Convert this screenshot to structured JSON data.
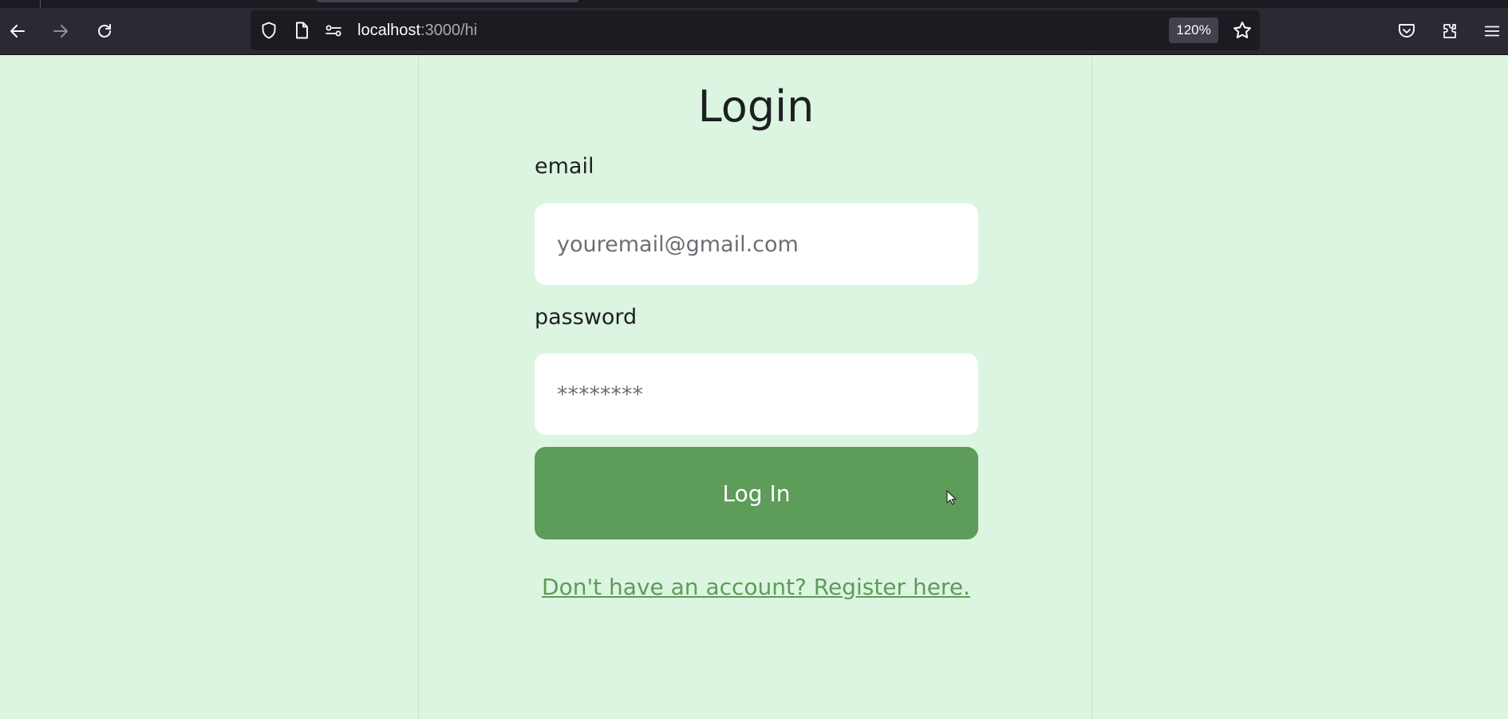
{
  "browser": {
    "url_host": "localhost",
    "url_rest": ":3000/hi",
    "zoom": "120%",
    "icons": {
      "back": "back-arrow-icon",
      "forward": "forward-arrow-icon",
      "reload": "reload-icon",
      "shield": "tracking-protection-shield-icon",
      "page": "page-info-icon",
      "permissions": "permissions-icon",
      "bookmark": "bookmark-star-icon",
      "pocket": "pocket-icon",
      "extensions": "extensions-icon",
      "menu": "hamburger-menu-icon"
    }
  },
  "login": {
    "title": "Login",
    "email_label": "email",
    "email_placeholder": "youremail@gmail.com",
    "email_value": "",
    "password_label": "password",
    "password_placeholder": "********",
    "password_value": "",
    "button_label": "Log In",
    "register_link": "Don't have an account? Register here."
  },
  "colors": {
    "page_background": "#dcf5e0",
    "accent": "#5d9c59",
    "text": "#1d1f22",
    "browser_chrome": "#2b2a33"
  }
}
